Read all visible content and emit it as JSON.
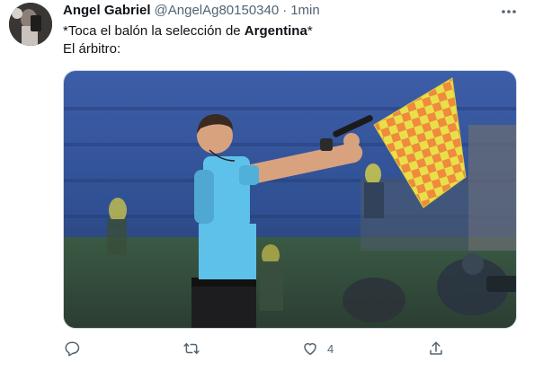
{
  "tweet": {
    "author_name": "Angel Gabriel",
    "author_handle": "@AngelAg80150340",
    "separator": "·",
    "time": "1min",
    "line1_prefix": "*Toca el balón la selección de ",
    "line1_bold": "Argentina",
    "line1_suffix": "*",
    "line2": "El árbitro:"
  },
  "actions": {
    "like_count": "4"
  },
  "icons": {
    "more": "more-icon",
    "reply": "reply-icon",
    "retweet": "retweet-icon",
    "like": "heart-icon",
    "share": "share-icon"
  },
  "colors": {
    "text": "#0f1419",
    "secondary": "#536471",
    "flag_yellow": "#e8e04a",
    "flag_orange": "#f08a3c",
    "shirt_blue": "#5ec1ea"
  }
}
